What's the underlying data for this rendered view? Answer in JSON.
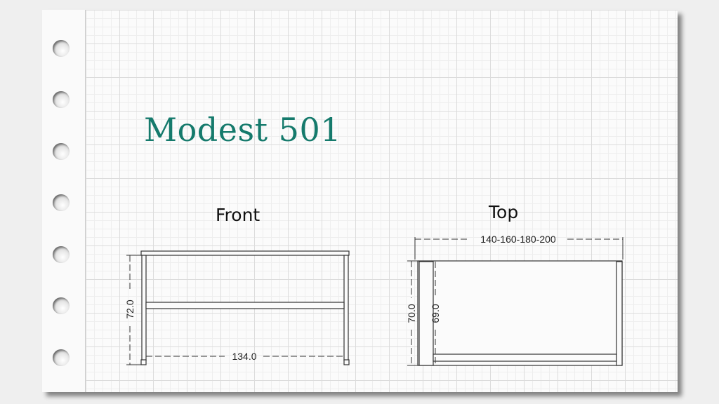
{
  "title": "Modest 501",
  "views": {
    "front": {
      "label": "Front",
      "dim_width": "134.0",
      "dim_height": "72.0"
    },
    "top": {
      "label": "Top",
      "dim_width": "140-160-180-200",
      "dim_outer_depth": "70.0",
      "dim_inner_depth": "69.0"
    }
  },
  "colors": {
    "title": "#157a6c",
    "line": "#333333"
  }
}
